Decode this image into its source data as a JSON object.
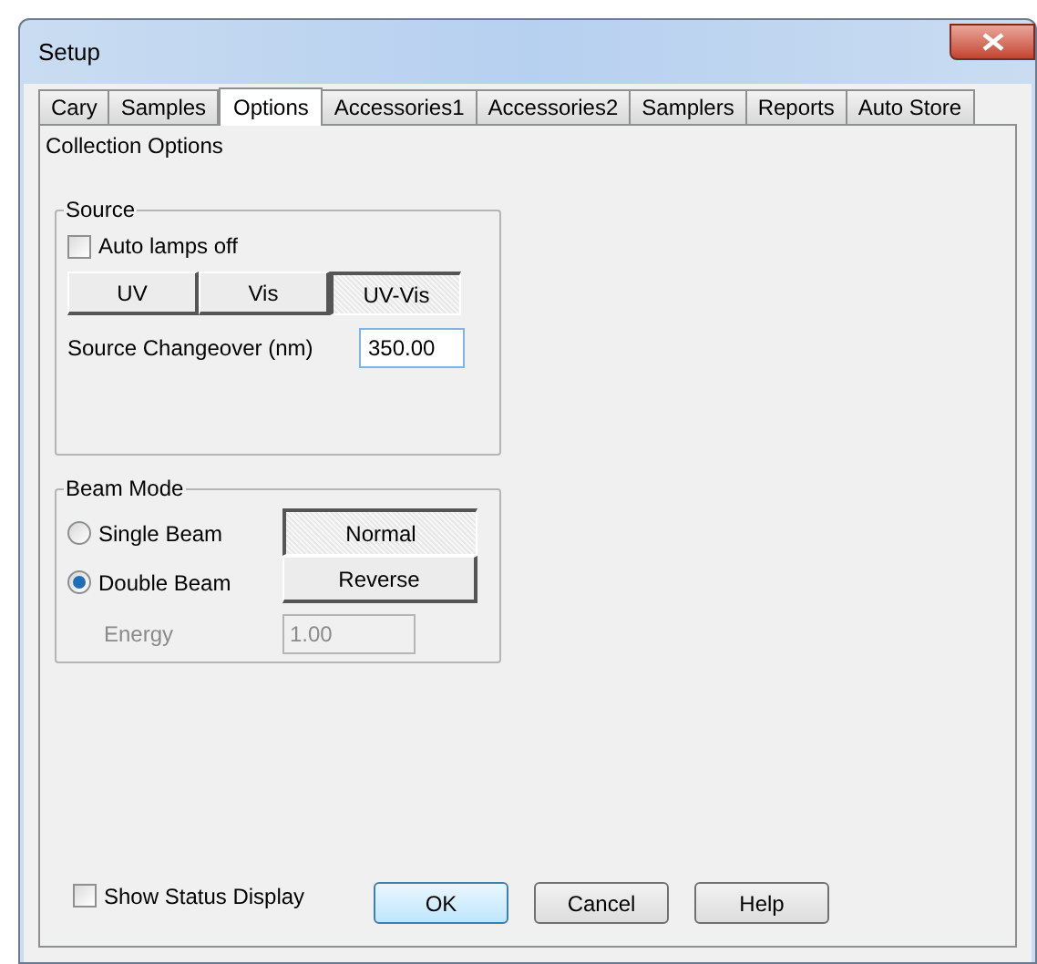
{
  "window": {
    "title": "Setup"
  },
  "tabs": [
    {
      "label": "Cary",
      "selected": false
    },
    {
      "label": "Samples",
      "selected": false
    },
    {
      "label": "Options",
      "selected": true
    },
    {
      "label": "Accessories1",
      "selected": false
    },
    {
      "label": "Accessories2",
      "selected": false
    },
    {
      "label": "Samplers",
      "selected": false
    },
    {
      "label": "Reports",
      "selected": false
    },
    {
      "label": "Auto Store",
      "selected": false
    }
  ],
  "page_heading": "Collection Options",
  "source": {
    "title": "Source",
    "auto_lamps_off": {
      "label": "Auto lamps off",
      "checked": false
    },
    "lamp_buttons": [
      {
        "label": "UV",
        "selected": false
      },
      {
        "label": "Vis",
        "selected": false
      },
      {
        "label": "UV-Vis",
        "selected": true
      }
    ],
    "changeover": {
      "label": "Source Changeover (nm)",
      "value": "350.00"
    }
  },
  "beam_mode": {
    "title": "Beam Mode",
    "options": [
      {
        "label": "Single Beam",
        "selected": false
      },
      {
        "label": "Double Beam",
        "selected": true
      }
    ],
    "buttons": [
      {
        "label": "Normal",
        "selected": true
      },
      {
        "label": "Reverse",
        "selected": false
      }
    ],
    "energy": {
      "label": "Energy",
      "value": "1.00",
      "disabled": true
    }
  },
  "show_status_display": {
    "label": "Show Status Display",
    "checked": false
  },
  "buttons": [
    {
      "label": "OK",
      "default": true
    },
    {
      "label": "Cancel",
      "default": false
    },
    {
      "label": "Help",
      "default": false
    }
  ]
}
